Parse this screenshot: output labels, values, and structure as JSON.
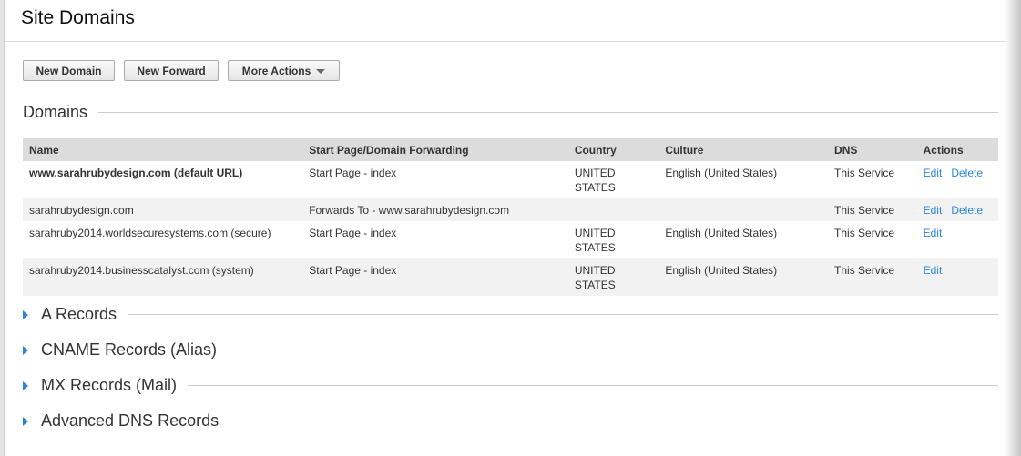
{
  "title": "Site Domains",
  "toolbar": {
    "new_domain": "New Domain",
    "new_forward": "New Forward",
    "more_actions": "More Actions"
  },
  "domains": {
    "heading": "Domains",
    "columns": [
      "Name",
      "Start Page/Domain Forwarding",
      "Country",
      "Culture",
      "DNS",
      "Actions"
    ],
    "rows": [
      {
        "name": "www.sarahrubydesign.com (default URL)",
        "start": "Start Page - index",
        "country": "UNITED STATES",
        "culture": "English (United States)",
        "dns": "This Service",
        "edit": "Edit",
        "delete": "Delete"
      },
      {
        "name": "sarahrubydesign.com",
        "start": "Forwards To - www.sarahrubydesign.com",
        "country": "",
        "culture": "",
        "dns": "This Service",
        "edit": "Edit",
        "delete": "Delete"
      },
      {
        "name": "sarahruby2014.worldsecuresystems.com (secure)",
        "start": "Start Page - index",
        "country": "UNITED STATES",
        "culture": "English (United States)",
        "dns": "This Service",
        "edit": "Edit"
      },
      {
        "name": "sarahruby2014.businesscatalyst.com (system)",
        "start": "Start Page - index",
        "country": "UNITED STATES",
        "culture": "English (United States)",
        "dns": "This Service",
        "edit": "Edit"
      }
    ]
  },
  "sections": [
    "A Records",
    "CNAME Records (Alias)",
    "MX Records (Mail)",
    "Advanced DNS Records"
  ]
}
